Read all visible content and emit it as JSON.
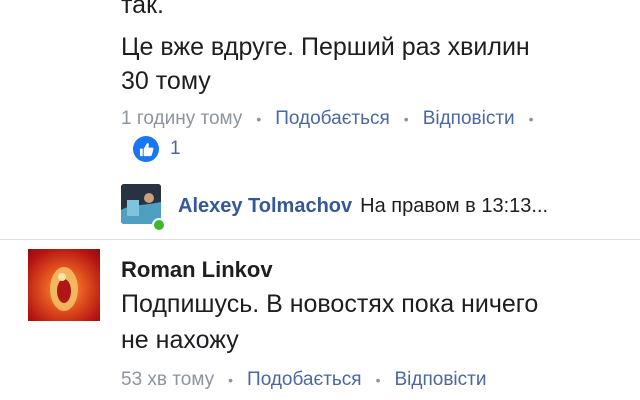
{
  "comment1": {
    "text_line0": "так.",
    "text_line1": "Це вже вдруге. Перший раз хвилин",
    "text_line2": "30 тому",
    "time": "1 годину тому",
    "like_label": "Подобається",
    "reply_label": "Відповісти",
    "sep": "•",
    "like_count": "1"
  },
  "reply_preview": {
    "author": "Alexey  Tolmachov",
    "snippet": "На правом в 13:13..."
  },
  "comment2": {
    "author": "Roman Linkov",
    "text_line1": "Подпишусь. В новостях пока ничего",
    "text_line2": "не нахожу",
    "time": "53 хв тому",
    "like_label": "Подобається",
    "reply_label": "Відповісти",
    "sep": "•"
  },
  "icons": {
    "like": "thumbs-up-icon",
    "online": "online-status-dot"
  },
  "colors": {
    "link": "#4b67a1",
    "name_link": "#365899",
    "like_blue": "#1877f2",
    "meta_gray": "#8d949e",
    "online_green": "#42b72a"
  }
}
